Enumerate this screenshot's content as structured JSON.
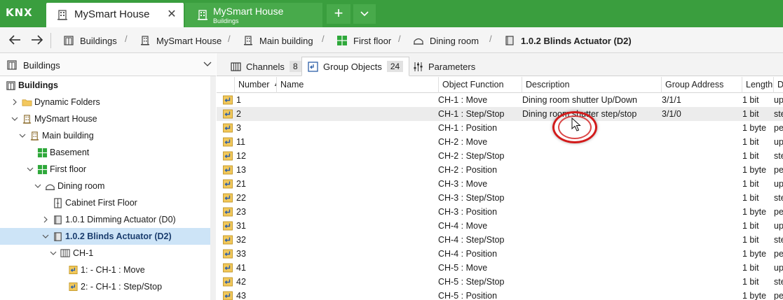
{
  "app": {
    "logo_text": "KNX",
    "brand_color": "#3a9e3e",
    "tabs": [
      {
        "title": "MySmart House",
        "subtitle": "",
        "active": true
      },
      {
        "title": "MySmart House",
        "subtitle": "Buildings",
        "active": false
      }
    ],
    "add_tab_label": "+",
    "tab_close_label": "✕"
  },
  "breadcrumb": {
    "items": [
      {
        "label": "Buildings",
        "icon": "buildings-icon"
      },
      {
        "label": "MySmart House",
        "icon": "building-icon"
      },
      {
        "label": "Main building",
        "icon": "building-icon"
      },
      {
        "label": "First floor",
        "icon": "floor-icon"
      },
      {
        "label": "Dining room",
        "icon": "room-icon"
      },
      {
        "label": "1.0.2 Blinds Actuator (D2)",
        "icon": "device-icon"
      }
    ],
    "separator": "/"
  },
  "left_panel": {
    "header": "Buildings",
    "tree": [
      {
        "label": "Buildings",
        "depth": 0,
        "icon": "buildings-icon",
        "twisty": "none",
        "bold": true
      },
      {
        "label": "Dynamic Folders",
        "depth": 1,
        "icon": "folder-icon",
        "twisty": "collapsed"
      },
      {
        "label": "MySmart House",
        "depth": 1,
        "icon": "building-icon",
        "twisty": "expanded"
      },
      {
        "label": "Main building",
        "depth": 2,
        "icon": "building-icon",
        "twisty": "expanded"
      },
      {
        "label": "Basement",
        "depth": 3,
        "icon": "floor-icon",
        "twisty": "none"
      },
      {
        "label": "First floor",
        "depth": 3,
        "icon": "floor-icon",
        "twisty": "expanded"
      },
      {
        "label": "Dining room",
        "depth": 4,
        "icon": "room-icon",
        "twisty": "expanded"
      },
      {
        "label": "Cabinet First Floor",
        "depth": 5,
        "icon": "cabinet-icon",
        "twisty": "none"
      },
      {
        "label": "1.0.1 Dimming Actuator (D0)",
        "depth": 5,
        "icon": "device-icon",
        "twisty": "collapsed"
      },
      {
        "label": "1.0.2 Blinds Actuator (D2)",
        "depth": 5,
        "icon": "device-icon",
        "twisty": "expanded",
        "selected": true
      },
      {
        "label": "CH-1",
        "depth": 6,
        "icon": "channel-icon",
        "twisty": "expanded"
      },
      {
        "label": "1:  - CH-1 : Move",
        "depth": 7,
        "icon": "group-object-icon",
        "twisty": "none"
      },
      {
        "label": "2:  - CH-1 : Step/Stop",
        "depth": 7,
        "icon": "group-object-icon",
        "twisty": "none"
      }
    ]
  },
  "subtabs": [
    {
      "label": "Channels",
      "count": "8",
      "icon": "channels-icon",
      "active": false
    },
    {
      "label": "Group Objects",
      "count": "24",
      "icon": "group-objects-icon",
      "active": true
    },
    {
      "label": "Parameters",
      "count": "",
      "icon": "parameters-icon",
      "active": false
    }
  ],
  "grid": {
    "columns": [
      "Number",
      "Name",
      "Object Function",
      "Description",
      "Group Address",
      "Length",
      "D"
    ],
    "sort_indicator": "▲",
    "rows": [
      {
        "number": "1",
        "name": "",
        "function": "CH-1 : Move",
        "description": "Dining room shutter Up/Down",
        "group_address": "3/1/1",
        "length": "1 bit",
        "d": "up"
      },
      {
        "number": "2",
        "name": "",
        "function": "CH-1 : Step/Stop",
        "description": "Dining room shutter step/stop",
        "group_address": "3/1/0",
        "length": "1 bit",
        "d": "ste"
      },
      {
        "number": "3",
        "name": "",
        "function": "CH-1 : Position",
        "description": "",
        "group_address": "",
        "length": "1 byte",
        "d": "pe"
      },
      {
        "number": "11",
        "name": "",
        "function": "CH-2 : Move",
        "description": "",
        "group_address": "",
        "length": "1 bit",
        "d": "up"
      },
      {
        "number": "12",
        "name": "",
        "function": "CH-2 : Step/Stop",
        "description": "",
        "group_address": "",
        "length": "1 bit",
        "d": "ste"
      },
      {
        "number": "13",
        "name": "",
        "function": "CH-2 : Position",
        "description": "",
        "group_address": "",
        "length": "1 byte",
        "d": "pe"
      },
      {
        "number": "21",
        "name": "",
        "function": "CH-3 : Move",
        "description": "",
        "group_address": "",
        "length": "1 bit",
        "d": "up"
      },
      {
        "number": "22",
        "name": "",
        "function": "CH-3 : Step/Stop",
        "description": "",
        "group_address": "",
        "length": "1 bit",
        "d": "ste"
      },
      {
        "number": "23",
        "name": "",
        "function": "CH-3 : Position",
        "description": "",
        "group_address": "",
        "length": "1 byte",
        "d": "pe"
      },
      {
        "number": "31",
        "name": "",
        "function": "CH-4 : Move",
        "description": "",
        "group_address": "",
        "length": "1 bit",
        "d": "up"
      },
      {
        "number": "32",
        "name": "",
        "function": "CH-4 : Step/Stop",
        "description": "",
        "group_address": "",
        "length": "1 bit",
        "d": "ste"
      },
      {
        "number": "33",
        "name": "",
        "function": "CH-4 : Position",
        "description": "",
        "group_address": "",
        "length": "1 byte",
        "d": "pe"
      },
      {
        "number": "41",
        "name": "",
        "function": "CH-5 : Move",
        "description": "",
        "group_address": "",
        "length": "1 bit",
        "d": "up"
      },
      {
        "number": "42",
        "name": "",
        "function": "CH-5 : Step/Stop",
        "description": "",
        "group_address": "",
        "length": "1 bit",
        "d": "ste"
      },
      {
        "number": "43",
        "name": "",
        "function": "CH-5 : Position",
        "description": "",
        "group_address": "",
        "length": "1 byte",
        "d": "pe"
      }
    ]
  }
}
